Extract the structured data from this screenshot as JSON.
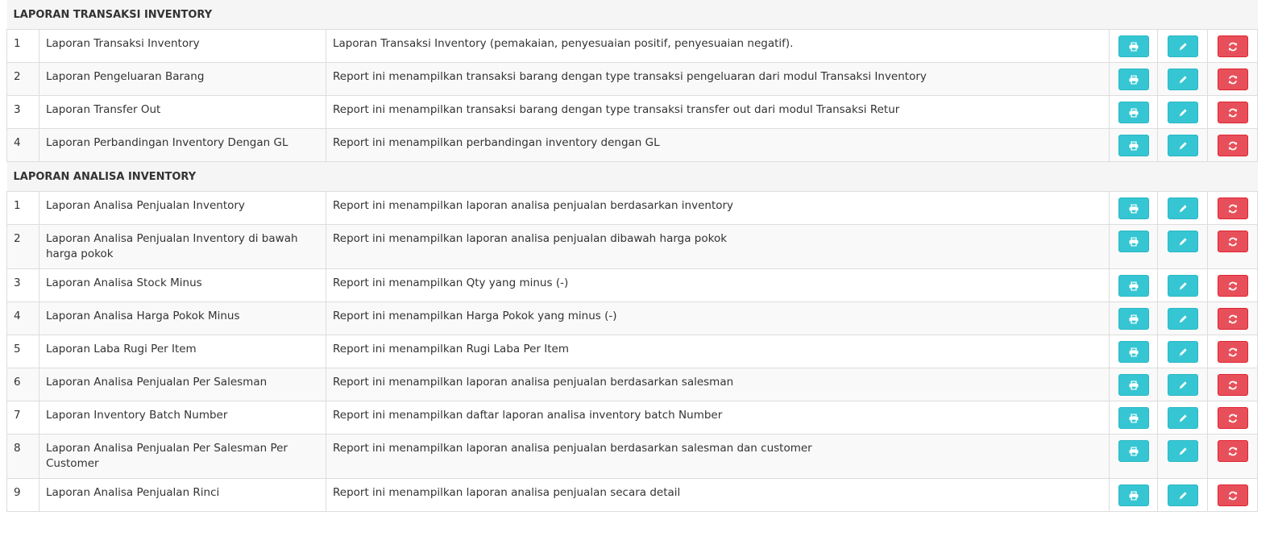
{
  "sections": [
    {
      "title": "LAPORAN TRANSAKSI INVENTORY",
      "rows": [
        {
          "no": "1",
          "name": "Laporan Transaksi Inventory",
          "desc": "Laporan Transaksi Inventory (pemakaian, penyesuaian positif, penyesuaian negatif)."
        },
        {
          "no": "2",
          "name": "Laporan Pengeluaran Barang",
          "desc": "Report ini menampilkan transaksi barang dengan type transaksi pengeluaran dari modul Transaksi Inventory"
        },
        {
          "no": "3",
          "name": "Laporan Transfer Out",
          "desc": "Report ini menampilkan transaksi barang dengan type transaksi transfer out dari modul Transaksi Retur"
        },
        {
          "no": "4",
          "name": "Laporan Perbandingan Inventory Dengan GL",
          "desc": "Report ini menampilkan perbandingan inventory dengan GL"
        }
      ]
    },
    {
      "title": "LAPORAN ANALISA INVENTORY",
      "rows": [
        {
          "no": "1",
          "name": "Laporan Analisa Penjualan Inventory",
          "desc": "Report ini menampilkan laporan analisa penjualan berdasarkan inventory"
        },
        {
          "no": "2",
          "name": "Laporan Analisa Penjualan Inventory di bawah harga pokok",
          "desc": "Report ini menampilkan laporan analisa penjualan dibawah harga pokok"
        },
        {
          "no": "3",
          "name": "Laporan Analisa Stock Minus",
          "desc": "Report ini menampilkan Qty yang minus (-)"
        },
        {
          "no": "4",
          "name": "Laporan Analisa Harga Pokok Minus",
          "desc": "Report ini menampilkan Harga Pokok yang minus (-)"
        },
        {
          "no": "5",
          "name": "Laporan Laba Rugi Per Item",
          "desc": "Report ini menampilkan Rugi Laba Per Item"
        },
        {
          "no": "6",
          "name": "Laporan Analisa Penjualan Per Salesman",
          "desc": "Report ini menampilkan laporan analisa penjualan berdasarkan salesman"
        },
        {
          "no": "7",
          "name": "Laporan Inventory Batch Number",
          "desc": "Report ini menampilkan daftar laporan analisa inventory batch Number"
        },
        {
          "no": "8",
          "name": "Laporan Analisa Penjualan Per Salesman Per Customer",
          "desc": "Report ini menampilkan laporan analisa penjualan berdasarkan salesman dan customer"
        },
        {
          "no": "9",
          "name": "Laporan Analisa Penjualan Rinci",
          "desc": "Report ini menampilkan laporan analisa penjualan secara detail"
        }
      ]
    }
  ],
  "actions": {
    "print_icon": "print-icon",
    "edit_icon": "pencil-icon",
    "reset_icon": "refresh-icon"
  },
  "colors": {
    "info": "#36c6d3",
    "danger": "#e7505a",
    "section_bg": "#f5f5f5",
    "border": "#dddddd"
  }
}
